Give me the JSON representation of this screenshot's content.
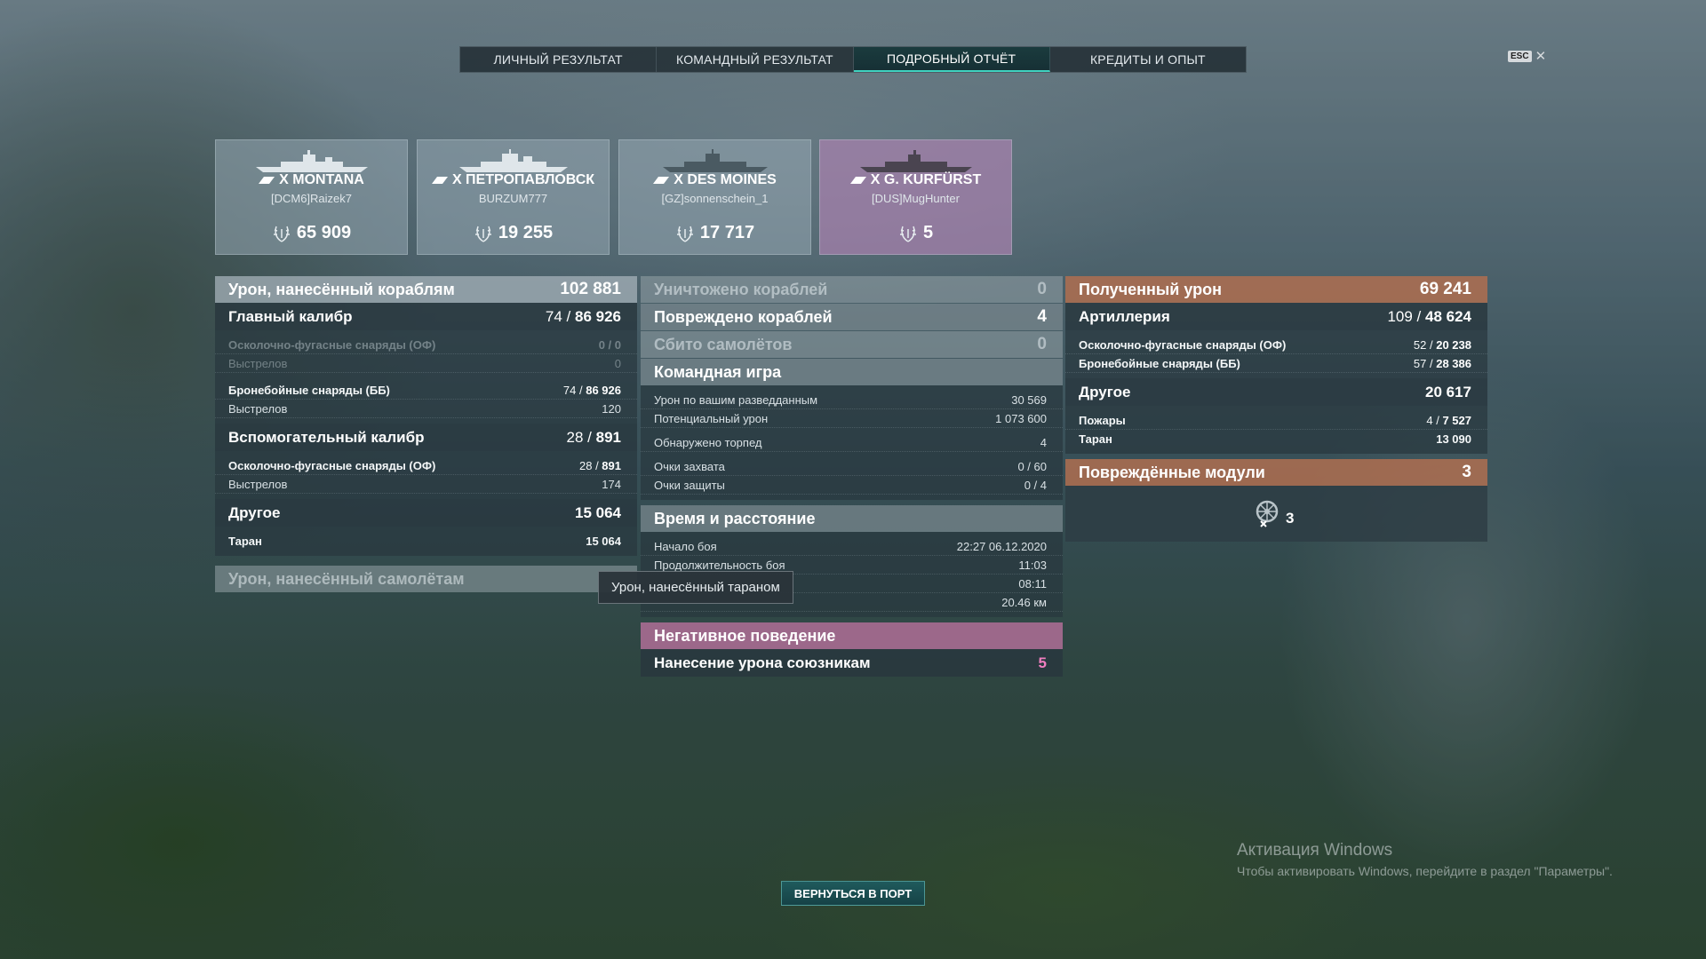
{
  "tabs": [
    {
      "label": "ЛИЧНЫЙ РЕЗУЛЬТАТ",
      "active": false
    },
    {
      "label": "КОМАНДНЫЙ РЕЗУЛЬТАТ",
      "active": false
    },
    {
      "label": "ПОДРОБНЫЙ ОТЧЁТ",
      "active": true
    },
    {
      "label": "КРЕДИТЫ И ОПЫТ",
      "active": false
    }
  ],
  "esc": {
    "key": "ESC",
    "close": "✕"
  },
  "ships": [
    {
      "name": "X MONTANA",
      "player": "[DCM6]Raizek7",
      "score": "65 909",
      "icon": "battleship-icon"
    },
    {
      "name": "X ПЕТРОПАВЛОВСК",
      "player": "BURZUM777",
      "score": "19 255",
      "icon": "cruiser-icon"
    },
    {
      "name": "X DES MOINES",
      "player": "[GZ]sonnenschein_1",
      "score": "17 717",
      "icon": "cruiser-icon"
    },
    {
      "name": "X G. KURFÜRST",
      "player": "[DUS]MugHunter",
      "score": "5",
      "icon": "battleship-icon"
    }
  ],
  "left": {
    "damage": {
      "label": "Урон, нанесённый кораблям",
      "value": "102 881"
    },
    "main": {
      "label": "Главный калибр",
      "hits": "74",
      "dmg": "86 926"
    },
    "he": {
      "label": "Осколочно-фугасные снаряды (ОФ)",
      "value": "0 / 0"
    },
    "he_shots": {
      "label": "Выстрелов",
      "value": "0"
    },
    "ap": {
      "label": "Бронебойные снаряды (ББ)",
      "hits": "74",
      "dmg": "86 926"
    },
    "ap_shots": {
      "label": "Выстрелов",
      "value": "120"
    },
    "secondary": {
      "label": "Вспомогательный калибр",
      "hits": "28",
      "dmg": "891"
    },
    "sec_he": {
      "label": "Осколочно-фугасные снаряды (ОФ)",
      "hits": "28",
      "dmg": "891"
    },
    "sec_shots": {
      "label": "Выстрелов",
      "value": "174"
    },
    "other": {
      "label": "Другое",
      "value": "15 064"
    },
    "ram": {
      "label": "Таран",
      "value": "15 064"
    },
    "planes": {
      "label": "Урон, нанесённый самолётам"
    }
  },
  "tooltip": "Урон, нанесённый тараном",
  "center": {
    "destroyed": {
      "label": "Уничтожено кораблей",
      "value": "0"
    },
    "damaged": {
      "label": "Повреждено кораблей",
      "value": "4"
    },
    "planes": {
      "label": "Сбито самолётов",
      "value": "0"
    },
    "team": {
      "label": "Командная игра"
    },
    "spotted_dmg": {
      "label": "Урон по вашим разведданным",
      "value": "30 569"
    },
    "potential": {
      "label": "Потенциальный урон",
      "value": "1 073 600"
    },
    "torps": {
      "label": "Обнаружено торпед",
      "value": "4"
    },
    "capture": {
      "label": "Очки захвата",
      "value": "0 / 60"
    },
    "defense": {
      "label": "Очки защиты",
      "value": "0 / 4"
    },
    "time": {
      "label": "Время и расстояние"
    },
    "start": {
      "label": "Начало боя",
      "value": "22:27  06.12.2020"
    },
    "duration": {
      "label": "Продолжительность боя",
      "value": "11:03"
    },
    "alive": {
      "value": "08:11"
    },
    "distance": {
      "value": "20.46 км"
    },
    "negative": {
      "label": "Негативное поведение"
    },
    "team_dmg": {
      "label": "Нанесение урона союзникам",
      "value": "5"
    }
  },
  "right": {
    "received": {
      "label": "Полученный урон",
      "value": "69 241"
    },
    "artillery": {
      "label": "Артиллерия",
      "hits": "109",
      "dmg": "48 624"
    },
    "he": {
      "label": "Осколочно-фугасные снаряды (ОФ)",
      "hits": "52",
      "dmg": "20 238"
    },
    "ap": {
      "label": "Бронебойные снаряды (ББ)",
      "hits": "57",
      "dmg": "28 386"
    },
    "other": {
      "label": "Другое",
      "value": "20 617"
    },
    "fires": {
      "label": "Пожары",
      "hits": "4",
      "dmg": "7 527"
    },
    "ram": {
      "label": "Таран",
      "value": "13 090"
    },
    "modules": {
      "label": "Повреждённые модули",
      "value": "3"
    },
    "module_count": "3"
  },
  "back_button": "ВЕРНУТЬСЯ В ПОРТ",
  "windows": {
    "title": "Активация Windows",
    "text": "Чтобы активировать Windows, перейдите в раздел \"Параметры\"."
  },
  "colors": {
    "accent": "#3fd2c0",
    "pink": "#f07ec0",
    "orange": "#af6e50"
  }
}
